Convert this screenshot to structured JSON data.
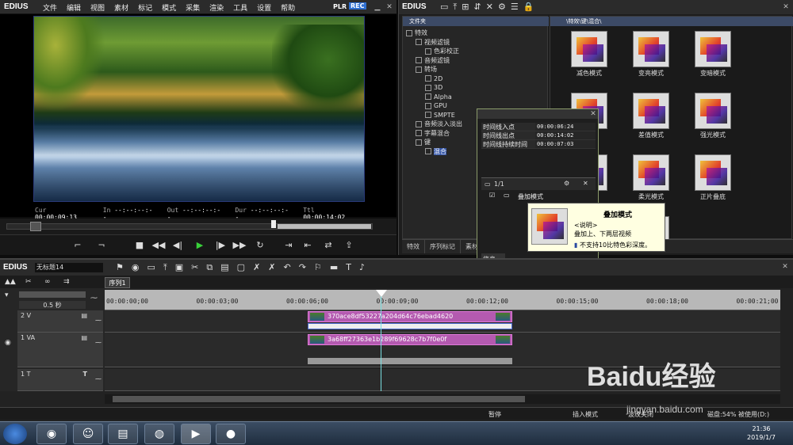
{
  "player": {
    "app_name": "EDIUS",
    "menu": [
      "文件",
      "编辑",
      "视图",
      "素材",
      "标记",
      "模式",
      "采集",
      "渲染",
      "工具",
      "设置",
      "帮助"
    ],
    "plr": "PLR",
    "rec": "REC",
    "timecodes": {
      "cur_label": "Cur",
      "cur": "00:00:09:13",
      "in_label": "In",
      "in": "--:--:--:--",
      "out_label": "Out",
      "out": "--:--:--:--",
      "dur_label": "Dur",
      "dur": "--:--:--:--",
      "ttl_label": "Ttl",
      "ttl": "00:00:14:02"
    }
  },
  "bin": {
    "app_name": "EDIUS",
    "folder_header": "文件夹",
    "fx_header": "\\特效\\键\\混合\\",
    "tree": [
      {
        "label": "特效",
        "indent": 0
      },
      {
        "label": "视频滤镜",
        "indent": 1
      },
      {
        "label": "色彩校正",
        "indent": 2
      },
      {
        "label": "音频滤镜",
        "indent": 1
      },
      {
        "label": "转场",
        "indent": 1
      },
      {
        "label": "2D",
        "indent": 2
      },
      {
        "label": "3D",
        "indent": 2
      },
      {
        "label": "Alpha",
        "indent": 2
      },
      {
        "label": "GPU",
        "indent": 2
      },
      {
        "label": "SMPTE",
        "indent": 2
      },
      {
        "label": "音频淡入淡出",
        "indent": 1
      },
      {
        "label": "字幕混合",
        "indent": 1
      },
      {
        "label": "键",
        "indent": 1
      },
      {
        "label": "混合",
        "indent": 2,
        "selected": true
      }
    ],
    "effects": [
      "减色模式",
      "变亮模式",
      "变暗模式",
      "",
      "差值模式",
      "强光模式",
      "",
      "柔光模式",
      "正片叠底",
      "",
      ""
    ],
    "tabs": [
      "特效",
      "序列标记",
      "素材"
    ]
  },
  "info_panel": {
    "rows": [
      {
        "key": "时间线入点",
        "value": "00:00:06:24"
      },
      {
        "key": "时间线出点",
        "value": "00:00:14:02"
      },
      {
        "key": "时间线持续时间",
        "value": "00:00:07:03"
      }
    ],
    "page": "1/1",
    "item": "叠加模式",
    "tab": "信息"
  },
  "tooltip": {
    "title": "叠加模式",
    "desc_label": "<说明>",
    "desc": "叠加上、下两层视频",
    "warning": "不支持10比特色彩深度。"
  },
  "timeline": {
    "app_name": "EDIUS",
    "project_name": "无标题14",
    "sequence_tab": "序列1",
    "zoom": "0.5 秒",
    "ruler_ticks": [
      "00:00:00;00",
      "00:00:03;00",
      "00:00:06;00",
      "00:00:09;00",
      "00:00:12;00",
      "00:00:15;00",
      "00:00:18;00",
      "00:00:21;00"
    ],
    "tracks": [
      {
        "name": "2 V",
        "clip": "370ace8df53227a204d64c76ebad4620"
      },
      {
        "name": "1 VA",
        "clip": "3a68ff27363e1b289f69628c7b7f0e0f"
      },
      {
        "name": "1 T",
        "clip": ""
      }
    ],
    "status": {
      "pause": "暂停",
      "insert": "插入模式",
      "ripple": "波纹关闭",
      "disk": "磁盘:54% 被使用(D:)"
    }
  },
  "taskbar": {
    "time": "21:36",
    "date": "2019/1/7"
  },
  "watermark": {
    "brand": "Baidu经验",
    "url": "jingyan.baidu.com"
  }
}
